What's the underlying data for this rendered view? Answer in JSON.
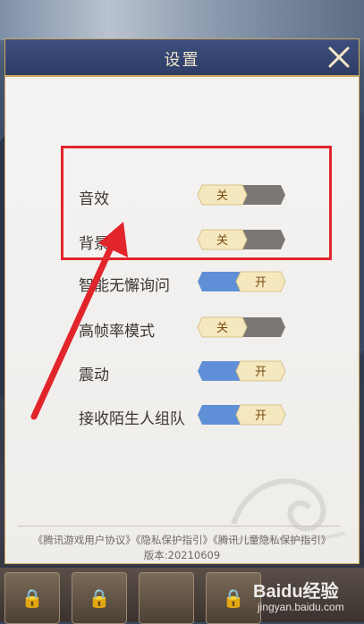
{
  "dialog": {
    "title": "设置"
  },
  "settings": [
    {
      "label": "音效",
      "state": "off",
      "toggle_text": "关"
    },
    {
      "label": "背景音",
      "state": "off",
      "toggle_text": "关"
    },
    {
      "label": "智能无懈询问",
      "state": "on",
      "toggle_text": "开"
    },
    {
      "label": "高帧率模式",
      "state": "off",
      "toggle_text": "关"
    },
    {
      "label": "震动",
      "state": "on",
      "toggle_text": "开"
    },
    {
      "label": "接收陌生人组队",
      "state": "on",
      "toggle_text": "开"
    }
  ],
  "footer": {
    "link_user_agreement": "《腾讯游戏用户协议》",
    "link_privacy": "《隐私保护指引》",
    "link_child_privacy": "《腾讯儿童隐私保护指引》",
    "version": "版本:20210609"
  },
  "watermark": {
    "brand": "Baidu经验",
    "url": "jingyan.baidu.com"
  },
  "colors": {
    "header_bg": "#2e3d66",
    "gold_border": "#c9a85c",
    "toggle_on_track": "#5f8fd6",
    "toggle_off_track": "#7a7775",
    "toggle_knob": "#f6e8be",
    "highlight_box": "#e2242b",
    "arrow": "#e2242b"
  }
}
